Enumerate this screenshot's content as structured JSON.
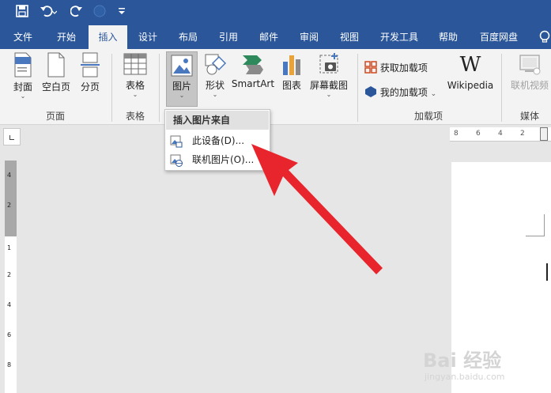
{
  "ribbon_tabs": [
    "文件",
    "开始",
    "插入",
    "设计",
    "布局",
    "引用",
    "邮件",
    "审阅",
    "视图",
    "开发工具",
    "帮助",
    "百度网盘"
  ],
  "groups": {
    "pages": {
      "label": "页面",
      "cover": "封面",
      "blank": "空白页",
      "break": "分页"
    },
    "tables": {
      "label": "表格",
      "table": "表格"
    },
    "illustrations": {
      "picture": "图片",
      "shapes": "形状",
      "smartart": "SmartArt",
      "chart": "图表",
      "screenshot": "屏幕截图"
    },
    "addins": {
      "label": "加载项",
      "get": "获取加载项",
      "mine": "我的加载项",
      "wikipedia": "Wikipedia"
    },
    "media": {
      "label": "媒体",
      "online_video": "联机视频"
    }
  },
  "dropdown": {
    "header": "插入图片来自",
    "this_device": "此设备(D)...",
    "online": "联机图片(O)..."
  },
  "ruler": {
    "h_ticks": [
      "8",
      "6",
      "4",
      "2"
    ],
    "v_ticks": [
      "4",
      "2",
      "1",
      "2",
      "4",
      "6",
      "8"
    ]
  },
  "watermark": {
    "brand": "Bai 经验",
    "url": "jingyan.baidu.com"
  },
  "colors": {
    "ribbon_blue": "#2b579a",
    "arrow": "#e8252c"
  }
}
